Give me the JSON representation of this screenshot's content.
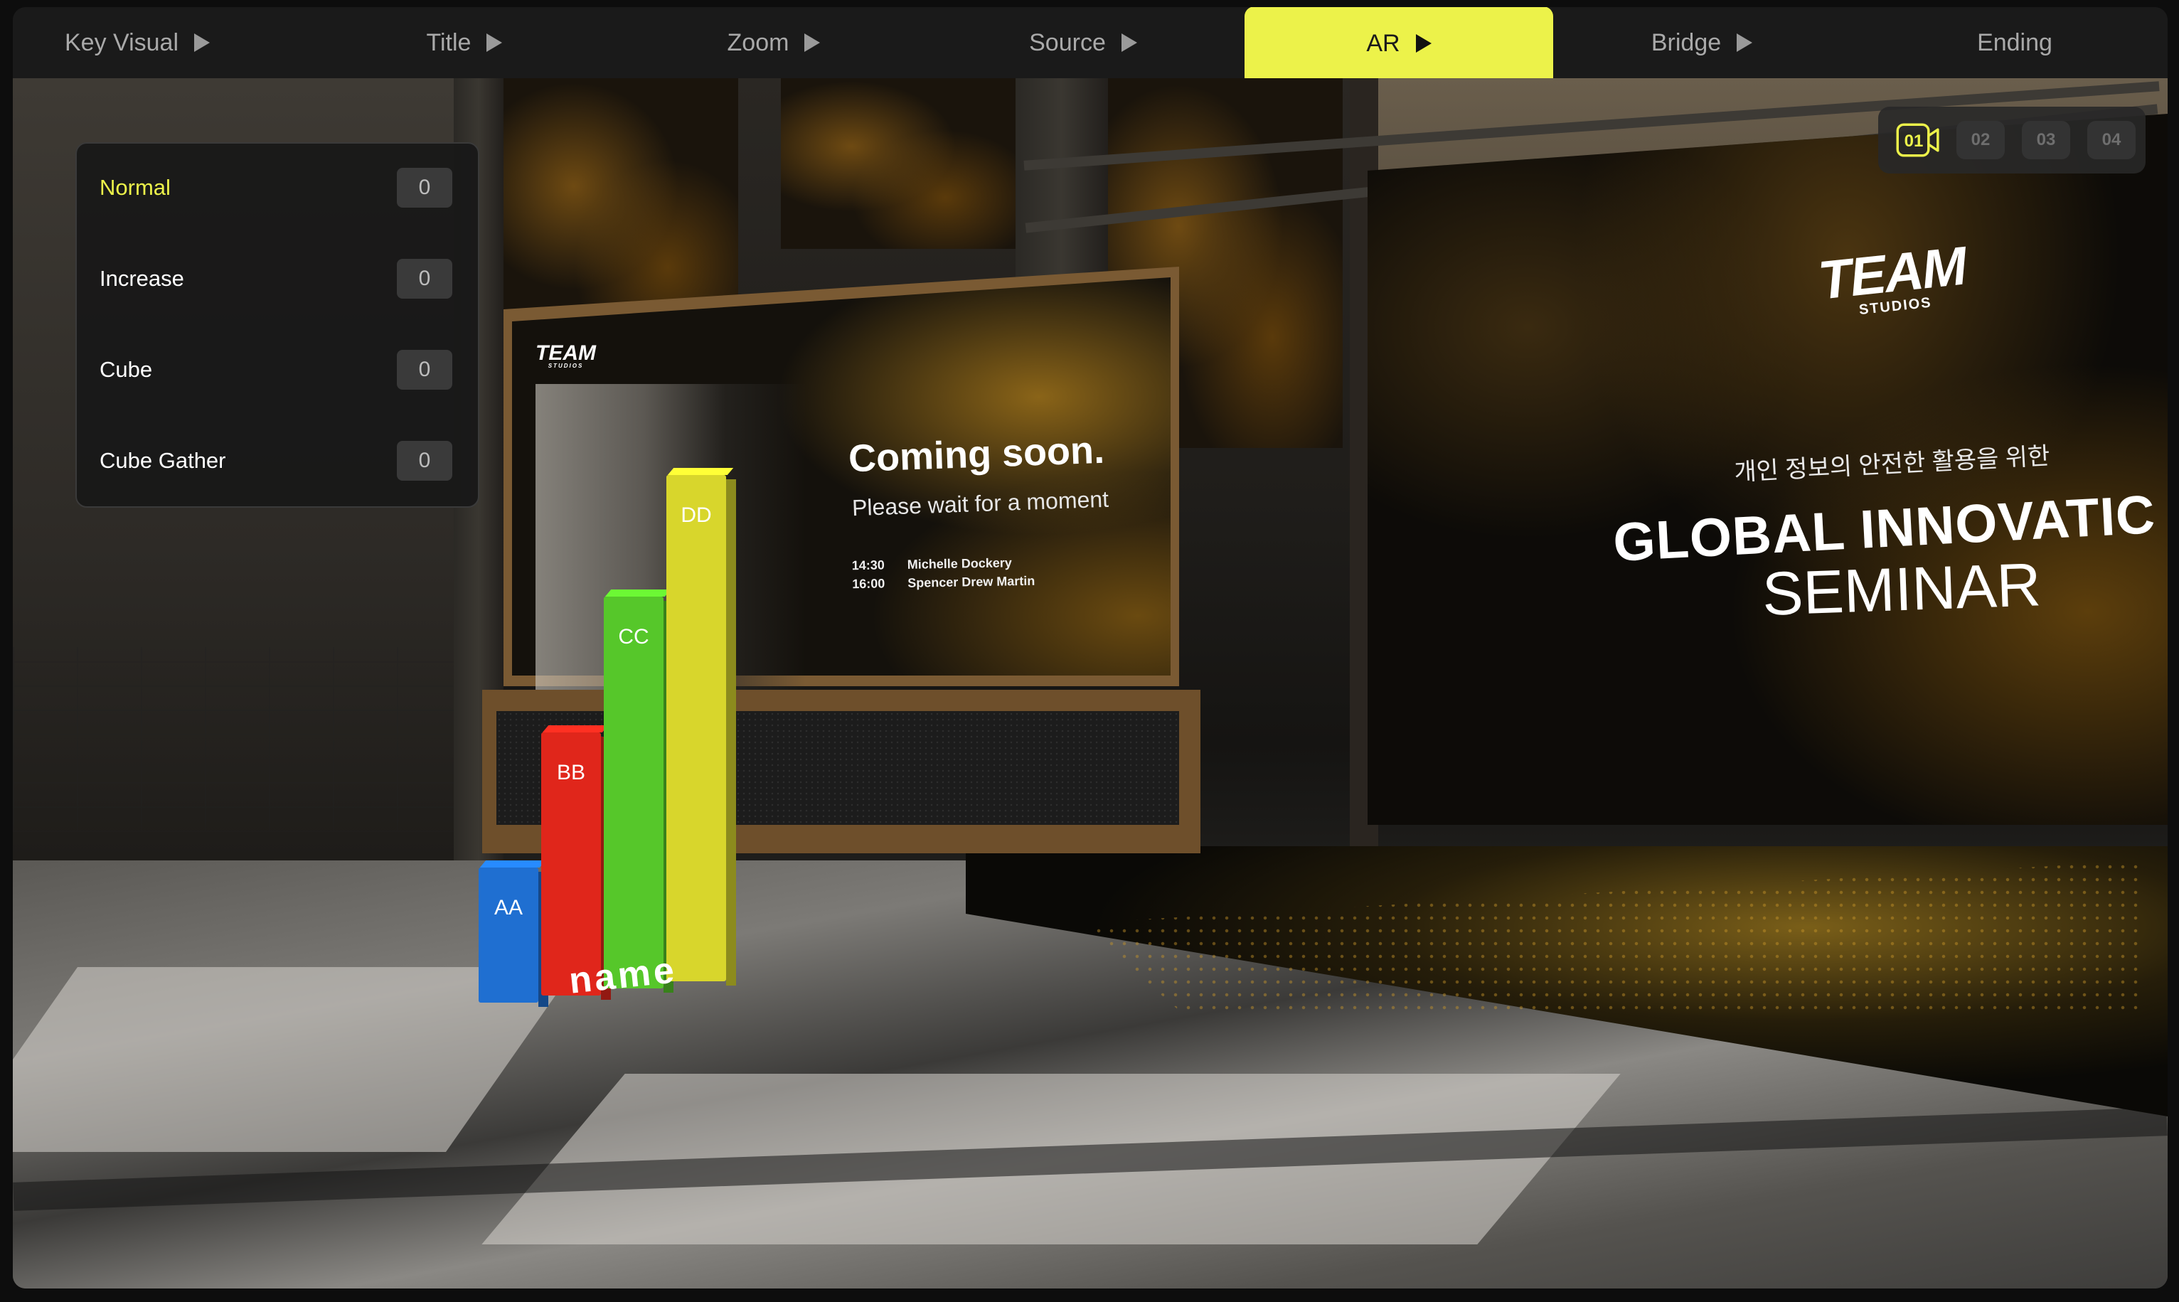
{
  "tabs": [
    {
      "label": "Key Visual",
      "has_play": true,
      "active": false
    },
    {
      "label": "Title",
      "has_play": true,
      "active": false
    },
    {
      "label": "Zoom",
      "has_play": true,
      "active": false
    },
    {
      "label": "Source",
      "has_play": true,
      "active": false
    },
    {
      "label": "AR",
      "has_play": true,
      "active": true
    },
    {
      "label": "Bridge",
      "has_play": true,
      "active": false
    },
    {
      "label": "Ending",
      "has_play": false,
      "active": false
    }
  ],
  "accent_color": "#ecf24a",
  "panel": {
    "items": [
      {
        "label": "Normal",
        "value": "0",
        "active": true
      },
      {
        "label": "Increase",
        "value": "0",
        "active": false
      },
      {
        "label": "Cube",
        "value": "0",
        "active": false
      },
      {
        "label": "Cube Gather",
        "value": "0",
        "active": false
      }
    ]
  },
  "cameras": {
    "icon": "video-camera-icon",
    "items": [
      "01",
      "02",
      "03",
      "04"
    ],
    "active": "01"
  },
  "scene": {
    "center_screen": {
      "logo": "TEAM",
      "logo_sub": "STUDIOS",
      "headline": "Coming soon.",
      "subline": "Please wait for a moment",
      "schedule": [
        {
          "time": "14:30",
          "name": "Michelle Dockery"
        },
        {
          "time": "16:00",
          "name": "Spencer Drew Martin"
        }
      ]
    },
    "right_screen": {
      "logo": "TEAM",
      "logo_sub": "STUDIOS",
      "korean_line": "개인 정보의 안전한 활용을 위한",
      "title_line1": "GLOBAL INNOVATIC",
      "title_line2": "SEMINAR"
    },
    "ar_chart": {
      "name_text": "name",
      "bars": [
        {
          "label": "AA",
          "value": 1.0,
          "color": "#1f6fd1"
        },
        {
          "label": "BB",
          "value": 1.95,
          "color": "#e0261b"
        },
        {
          "label": "CC",
          "value": 2.9,
          "color": "#56c72a"
        },
        {
          "label": "DD",
          "value": 3.75,
          "color": "#d8d62c"
        }
      ]
    }
  }
}
